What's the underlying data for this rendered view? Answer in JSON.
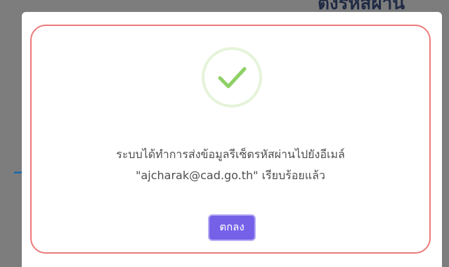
{
  "background": {
    "heading_fragment": "ตั้งรหัสผ่าน"
  },
  "dialog": {
    "icon": "check-icon",
    "message_line1": "ระบบได้ทำการส่งข้อมูลรีเซ็ตรหัสผ่านไปยังอีเมล์",
    "message_line2": "\"ajcharak@cad.go.th\" เรียบร้อยแล้ว",
    "ok_label": "ตกลง"
  },
  "colors": {
    "overlay": "#7d7d7d",
    "dialog_border": "#ee7a7a",
    "success_green": "#8ed065",
    "button": "#7461e8"
  }
}
